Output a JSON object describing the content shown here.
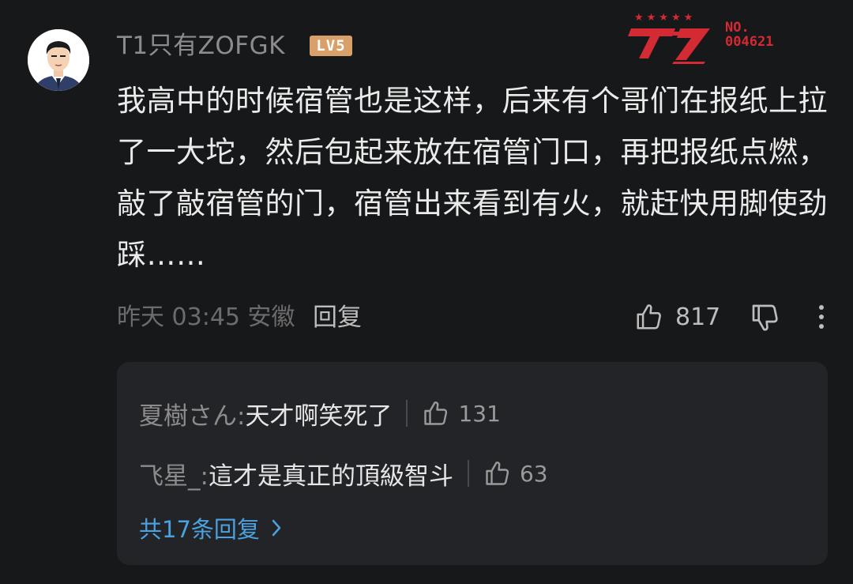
{
  "comment": {
    "avatar_icon": "user-avatar-cartoon-icon",
    "username": "T1只有ZOFGK",
    "level": "LV5",
    "fan_badge": {
      "icon": "t1-logo-icon",
      "stars": "★★★★★",
      "number_label": "NO.\n004621",
      "color": "#d42a33"
    },
    "text": "我高中的时候宿管也是这样，后来有个哥们在报纸上拉了一大坨，然后包起来放在宿管门口，再把报纸点燃，敲了敲宿管的门，宿管出来看到有火，就赶快用脚使劲踩……",
    "meta": "昨天 03:45 安徽",
    "reply_label": "回复",
    "like_count": "817",
    "like_icon": "thumbs-up-icon",
    "dislike_icon": "thumbs-down-icon",
    "more_icon": "more-vertical-icon"
  },
  "replies": [
    {
      "author": "夏樹さん: ",
      "text": "天才啊笑死了",
      "likes": "131"
    },
    {
      "author": "飞星_: ",
      "text": "這才是真正的頂級智斗",
      "likes": "63"
    }
  ],
  "all_replies_label": "共17条回复",
  "colors": {
    "background": "#17181a",
    "reply_box": "#232427",
    "link": "#4aa3e0",
    "level_badge": "#d9a06a"
  }
}
